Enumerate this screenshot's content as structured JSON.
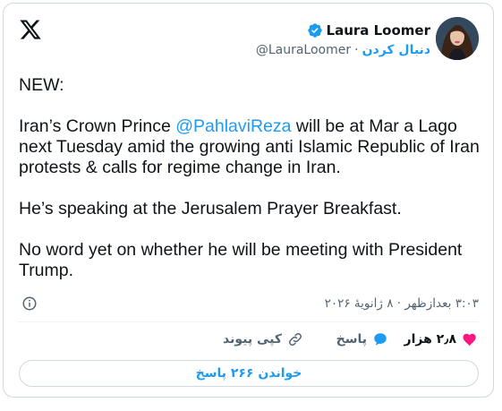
{
  "author": {
    "display_name": "Laura Loomer",
    "handle": "@LauraLoomer",
    "follow_label": "دنبال کردن",
    "separator": "·"
  },
  "tweet": {
    "line1": "NEW:",
    "p2_before": "Iran’s Crown Prince ",
    "mention": "@PahlaviReza",
    "p2_after": " will be at Mar a Lago next Tuesday amid the growing anti Islamic Republic of Iran protests & calls for regime change in Iran.",
    "p3": "He’s speaking at the Jerusalem Prayer Breakfast.",
    "p4": "No word yet on whether he will be meeting with President Trump."
  },
  "timestamp": "۳:۰۳ بعدازظهر · ۸ ژانویهٔ ۲۰۲۶",
  "actions": {
    "likes": "۲٫۸ هزار",
    "reply": "پاسخ",
    "copy_link": "کپی پیوند"
  },
  "read_replies": "خواندن ۲۶۶ پاسخ",
  "colors": {
    "accent": "#1d9bf0",
    "like": "#f91880",
    "text": "#0f1419",
    "muted": "#536471",
    "border": "#cfd9de"
  },
  "icons": [
    "x-logo-icon",
    "verified-badge-icon",
    "info-icon",
    "heart-icon",
    "reply-bubble-icon",
    "link-icon"
  ]
}
